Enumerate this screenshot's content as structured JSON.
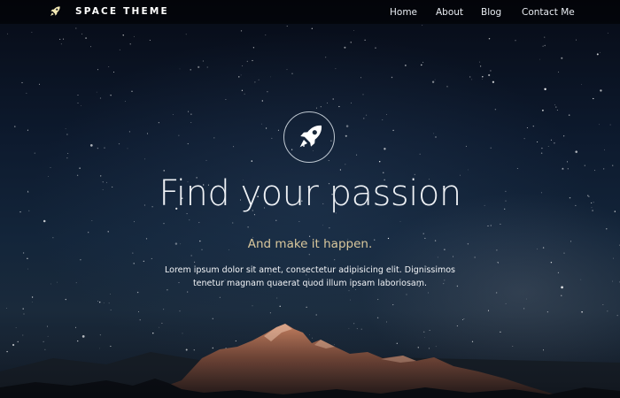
{
  "brand": {
    "name": "SPACE THEME",
    "icon": "rocket-icon"
  },
  "nav": {
    "items": [
      {
        "label": "Home"
      },
      {
        "label": "About"
      },
      {
        "label": "Blog"
      },
      {
        "label": "Contact Me"
      }
    ]
  },
  "hero": {
    "icon": "rocket-icon",
    "title": "Find your passion",
    "subtitle": "And make it happen.",
    "description": "Lorem ipsum dolor sit amet, consectetur adipisicing elit. Dignissimos tenetur magnam quaerat quod illum ipsam laboriosam."
  },
  "colors": {
    "navbar_bg": "#000000",
    "subtitle": "#d9c79c",
    "text": "#ffffff",
    "sky": "#0d1a2e"
  }
}
